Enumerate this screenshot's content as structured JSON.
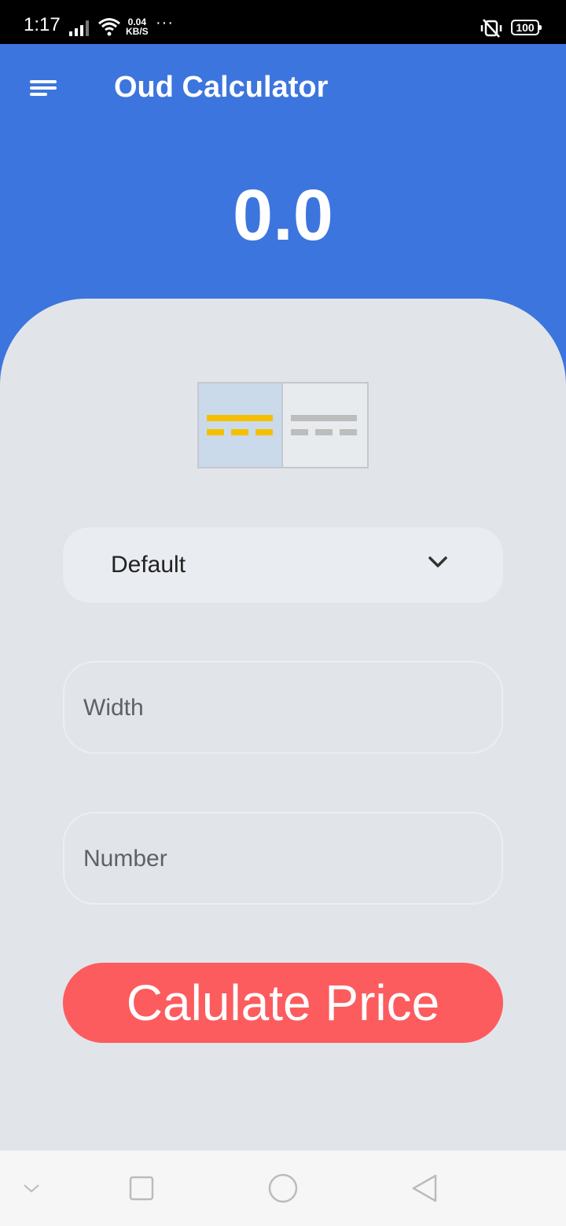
{
  "status_bar": {
    "time": "1:17",
    "net_speed_value": "0.04",
    "net_speed_unit": "KB/S",
    "more": "···",
    "battery": "100"
  },
  "app_bar": {
    "menu_icon": "menu-icon",
    "title": "Oud Calculator"
  },
  "result": {
    "value": "0.0"
  },
  "mode_toggle": {
    "options": [
      {
        "icon": "single-line-layout-icon",
        "selected": true,
        "accent": "#f6c000"
      },
      {
        "icon": "single-line-layout-icon",
        "selected": false,
        "accent": "#bdbdbd"
      }
    ]
  },
  "dropdown": {
    "selected": "Default"
  },
  "fields": {
    "width_placeholder": "Width",
    "number_placeholder": "Number"
  },
  "button": {
    "label": "Calulate Price"
  },
  "nav_bar": {
    "icons": [
      "collapse-icon",
      "recents-icon",
      "home-icon",
      "back-icon"
    ]
  },
  "colors": {
    "primary": "#3d75de",
    "card_background": "#e1e5ea",
    "button": "#fc5c5e",
    "selected_toggle": "#cbdaea"
  }
}
